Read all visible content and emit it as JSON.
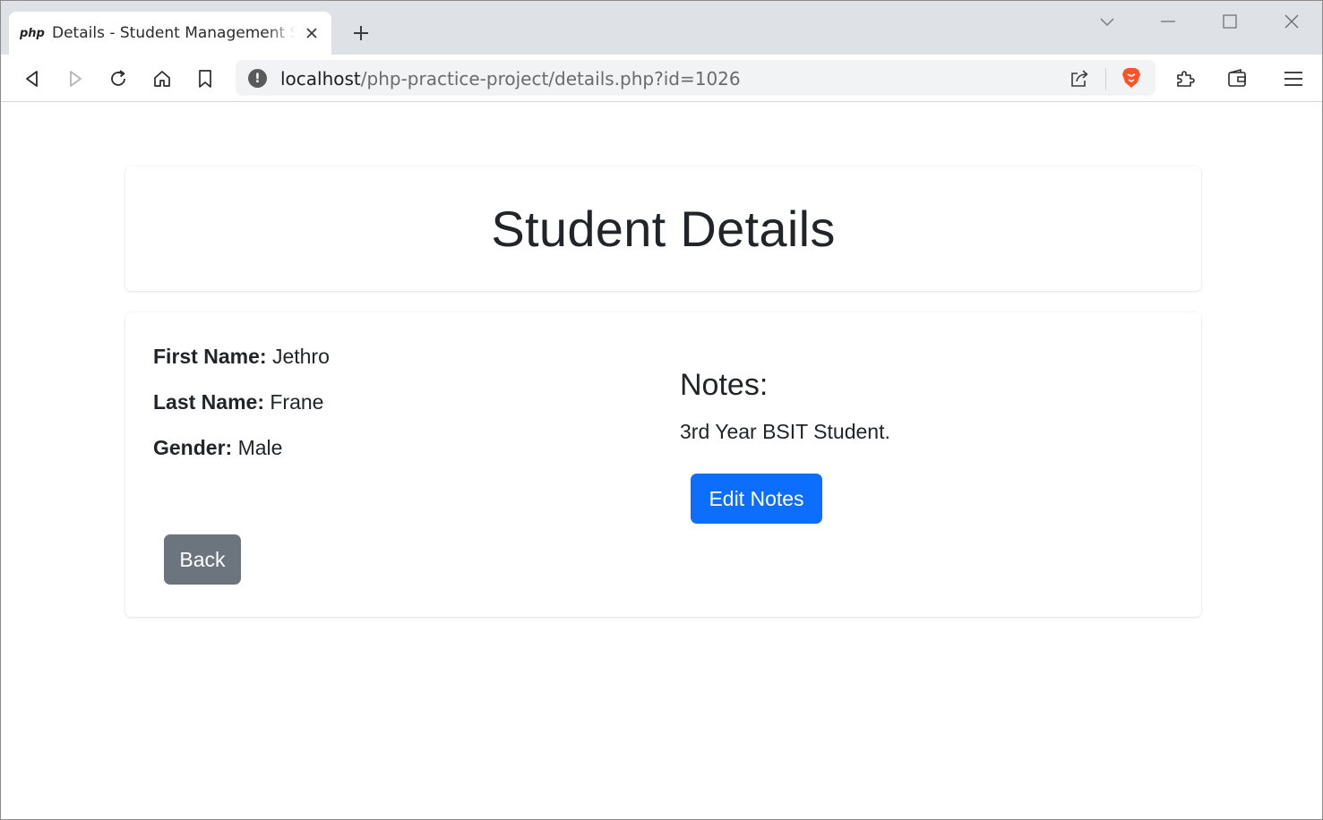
{
  "browser": {
    "tab": {
      "favicon_text": "php",
      "title": "Details - Student Management System"
    },
    "address_bar": {
      "host": "localhost",
      "path": "/php-practice-project/details.php?id=1026"
    },
    "accent_color": "#fb542b"
  },
  "page": {
    "header": {
      "title": "Student Details"
    },
    "student": {
      "first_name_label": "First Name:",
      "first_name": "Jethro",
      "last_name_label": "Last Name:",
      "last_name": "Frane",
      "gender_label": "Gender:",
      "gender": "Male"
    },
    "notes": {
      "heading": "Notes:",
      "text": "3rd Year BSIT Student.",
      "edit_button_label": "Edit Notes"
    },
    "back_button_label": "Back",
    "colors": {
      "primary": "#0d6efd",
      "secondary": "#6c757d",
      "text": "#212529"
    }
  }
}
